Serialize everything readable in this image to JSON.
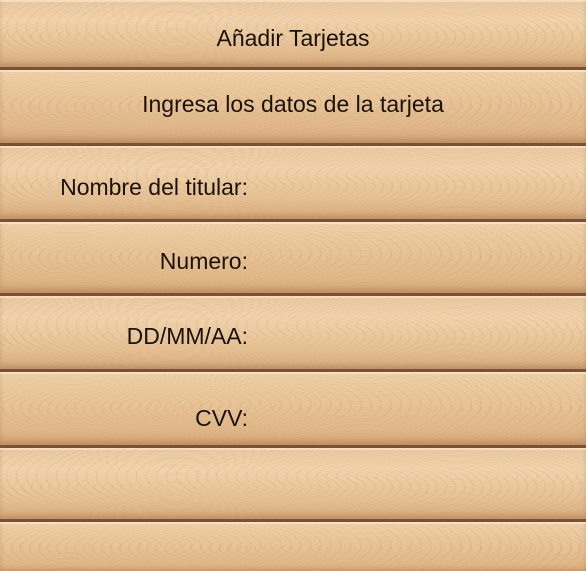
{
  "header": {
    "title": "Añadir Tarjetas",
    "subtitle": "Ingresa los datos de la tarjeta"
  },
  "form": {
    "holder_label": "Nombre del titular:",
    "holder_value": "",
    "number_label": "Numero:",
    "number_value": "",
    "expiry_label": "DD/MM/AA:",
    "expiry_value": "",
    "cvv_label": "CVV:",
    "cvv_value": ""
  }
}
